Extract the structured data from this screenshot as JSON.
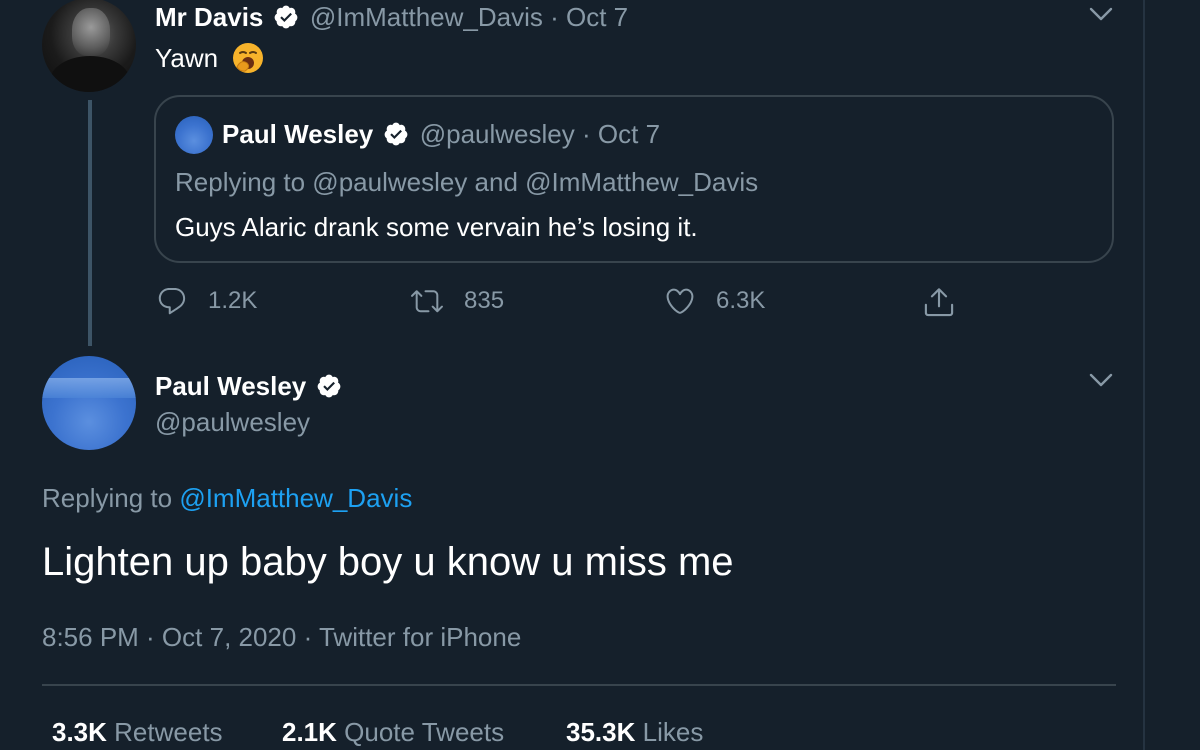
{
  "top_tweet": {
    "author_name": "Mr Davis",
    "author_handle": "@ImMatthew_Davis",
    "separator": "·",
    "date": "Oct 7",
    "text": "Yawn",
    "emoji": "yawning-face-emoji",
    "quoted_tweet": {
      "author_name": "Paul Wesley",
      "author_handle": "@paulwesley",
      "separator": "·",
      "date": "Oct 7",
      "replying_to": "Replying to @paulwesley and @ImMatthew_Davis",
      "text": "Guys Alaric drank some vervain he’s losing it."
    },
    "actions": {
      "replies": "1.2K",
      "retweets": "835",
      "likes": "6.3K"
    }
  },
  "main_tweet": {
    "author_name": "Paul Wesley",
    "author_handle": "@paulwesley",
    "replying_label": "Replying to",
    "replying_handle": "@ImMatthew_Davis",
    "text": "Lighten up baby boy u know u miss me",
    "timestamp": "8:56 PM · Oct 7, 2020 · Twitter for iPhone",
    "stats": {
      "retweets_count": "3.3K",
      "retweets_label": "Retweets",
      "quote_count": "2.1K",
      "quote_label": "Quote Tweets",
      "likes_count": "35.3K",
      "likes_label": "Likes"
    }
  },
  "colors": {
    "background": "#15202b",
    "text": "#ffffff",
    "muted": "#8899a6",
    "link": "#1da1f2",
    "border": "#38444d"
  },
  "icons": [
    "verified-badge-icon",
    "chevron-down-icon",
    "reply-icon",
    "retweet-icon",
    "like-icon",
    "share-icon"
  ]
}
